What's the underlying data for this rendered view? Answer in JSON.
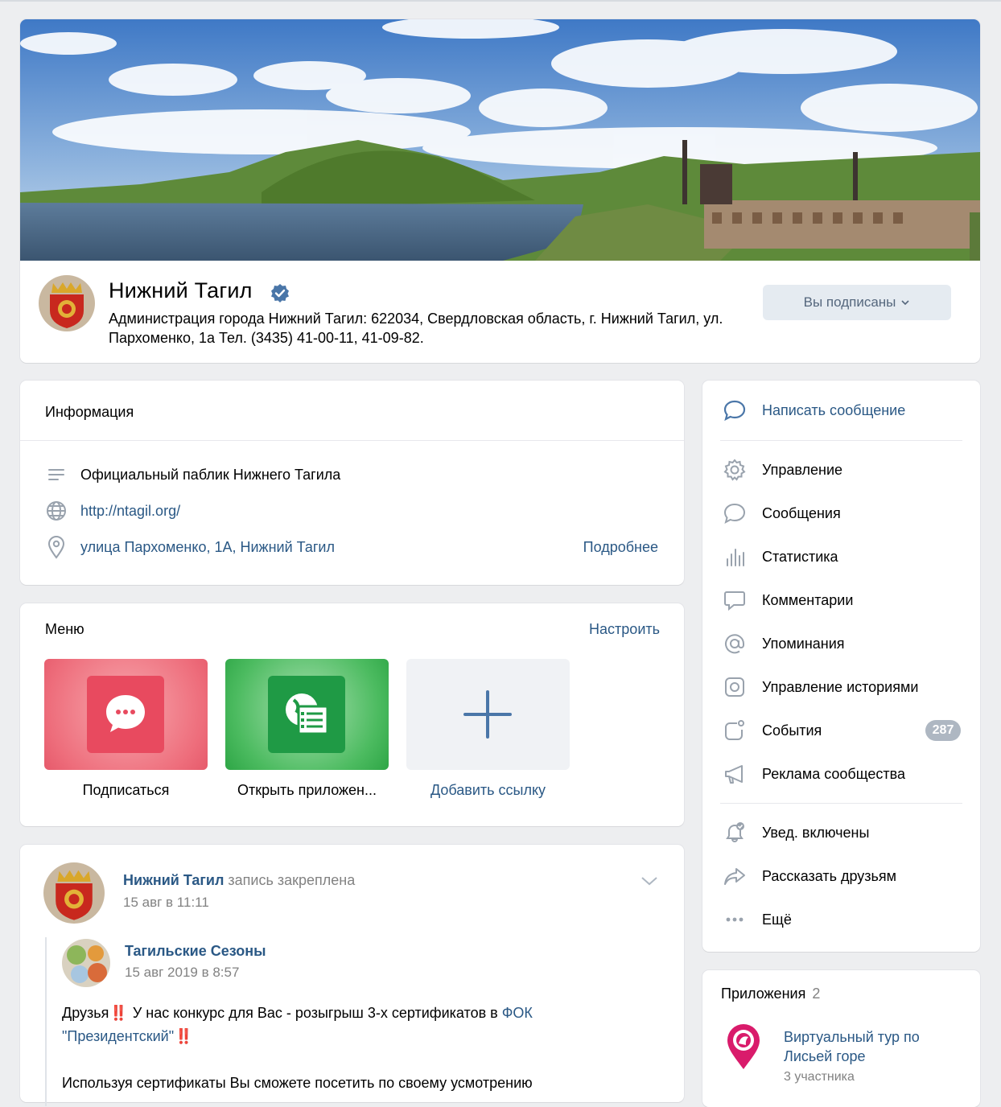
{
  "group": {
    "name": "Нижний Тагил",
    "status": "Администрация города Нижний Тагил: 622034, Свердловская область, г. Нижний Тагил, ул. Пархоменко, 1а Тел. (3435) 41-00-11, 41-09-82.",
    "subscribe_button": "Вы подписаны"
  },
  "info": {
    "title": "Информация",
    "description": "Официальный паблик Нижнего Тагила",
    "website": "http://ntagil.org/",
    "address": "улица Пархоменко, 1А, Нижний Тагил",
    "more": "Подробнее"
  },
  "menu": {
    "title": "Меню",
    "setup": "Настроить",
    "items": [
      {
        "label": "Подписаться"
      },
      {
        "label": "Открыть приложен..."
      },
      {
        "label": "Добавить ссылку"
      }
    ]
  },
  "post": {
    "author": "Нижний Тагил",
    "action": "запись закреплена",
    "time": "15 авг в 11:11",
    "repost_author": "Тагильские Сезоны",
    "repost_time": "15 авг 2019 в 8:57",
    "text_1": "Друзья",
    "text_2": "У нас конкурс для Вас - розыгрыш 3-х сертификатов в",
    "text_link": "ФОК \"Президентский\"",
    "excl": "‼️",
    "text_3": "Используя сертификаты Вы сможете посетить по своему усмотрению"
  },
  "actions": {
    "write_message": "Написать сообщение",
    "manage": "Управление",
    "messages": "Сообщения",
    "statistics": "Статистика",
    "comments": "Комментарии",
    "mentions": "Упоминания",
    "stories": "Управление историями",
    "events": "События",
    "events_count": "287",
    "ads": "Реклама сообщества",
    "notifications": "Увед. включены",
    "share": "Рассказать друзьям",
    "more": "Ещё"
  },
  "apps": {
    "title": "Приложения",
    "count": "2",
    "app_name": "Виртуальный тур по Лисьей горе",
    "app_members": "3 участника"
  },
  "colors": {
    "link": "#2a5885",
    "background": "#edeef0",
    "accent": "#4a76a8",
    "verified": "#4a76a8"
  }
}
